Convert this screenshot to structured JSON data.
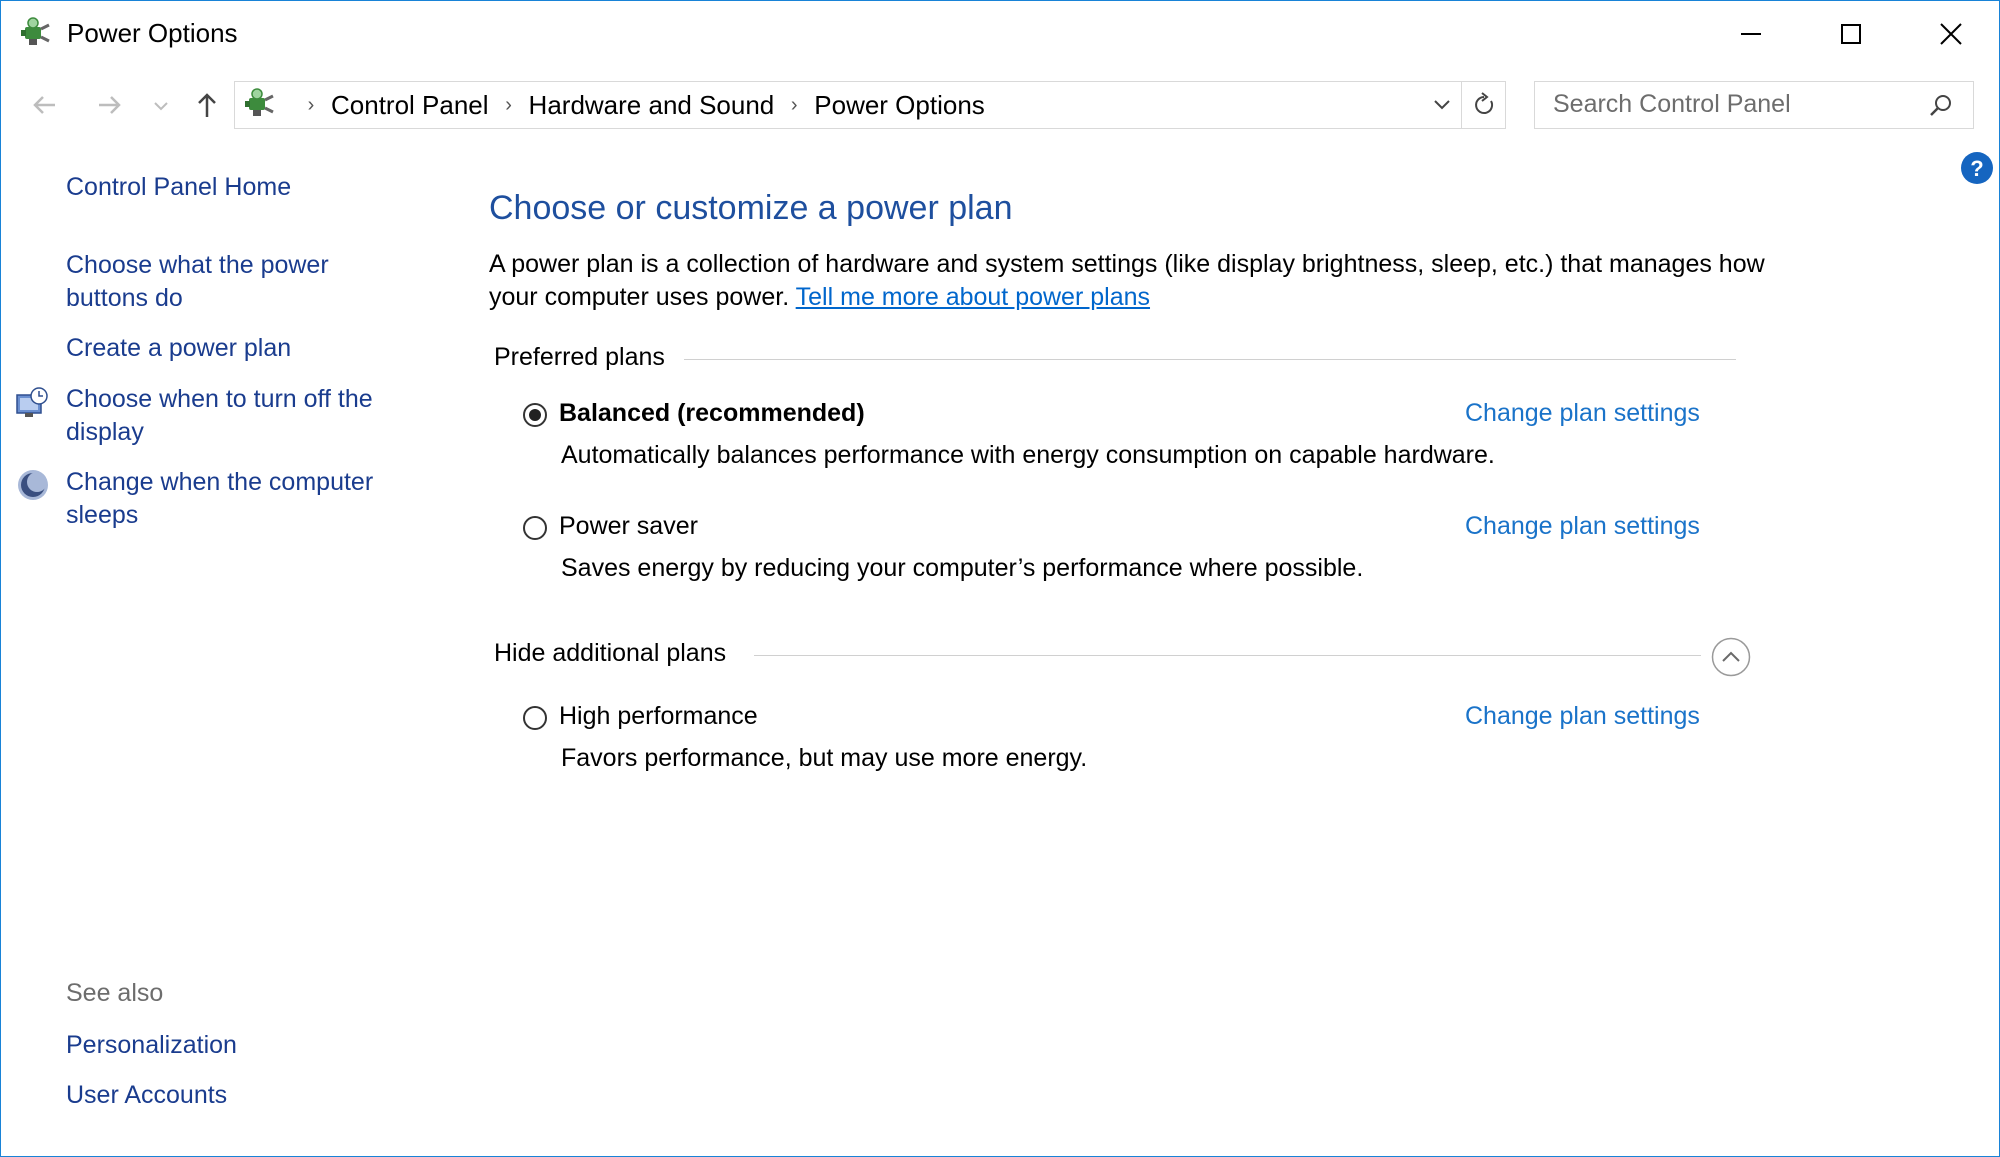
{
  "window": {
    "title": "Power Options",
    "minimize_glyph": "minimize-icon",
    "maximize_glyph": "maximize-icon",
    "close_glyph": "close-icon"
  },
  "navigation": {
    "breadcrumbs": [
      "Control Panel",
      "Hardware and Sound",
      "Power Options"
    ],
    "search_placeholder": "Search Control Panel"
  },
  "left_pane": {
    "home_link": "Control Panel Home",
    "tasks": [
      {
        "label": "Choose what the power buttons do",
        "icon": ""
      },
      {
        "label": "Create a power plan",
        "icon": ""
      },
      {
        "label": "Choose when to turn off the display",
        "icon": "display-timer-icon"
      },
      {
        "label": "Change when the computer sleeps",
        "icon": "sleep-moon-icon"
      }
    ],
    "see_also_heading": "See also",
    "see_also": [
      "Personalization",
      "User Accounts"
    ]
  },
  "main": {
    "title": "Choose or customize a power plan",
    "description": "A power plan is a collection of hardware and system settings (like display brightness, sleep, etc.) that manages how your computer uses power.",
    "description_link": "Tell me more about power plans",
    "preferred_heading": "Preferred plans",
    "additional_heading": "Hide additional plans",
    "plans": [
      {
        "name": "Balanced (recommended)",
        "description": "Automatically balances performance with energy consumption on capable hardware.",
        "selected": true,
        "link": "Change plan settings"
      },
      {
        "name": "Power saver",
        "description": "Saves energy by reducing your computer’s performance where possible.",
        "selected": false,
        "link": "Change plan settings"
      },
      {
        "name": "High performance",
        "description": "Favors performance, but may use more energy.",
        "selected": false,
        "link": "Change plan settings"
      }
    ]
  },
  "colors": {
    "title_blue": "#1e4f9e",
    "link_blue": "#1a73c9",
    "nav_link": "#1a3c8e",
    "window_border": "#1883d7"
  }
}
